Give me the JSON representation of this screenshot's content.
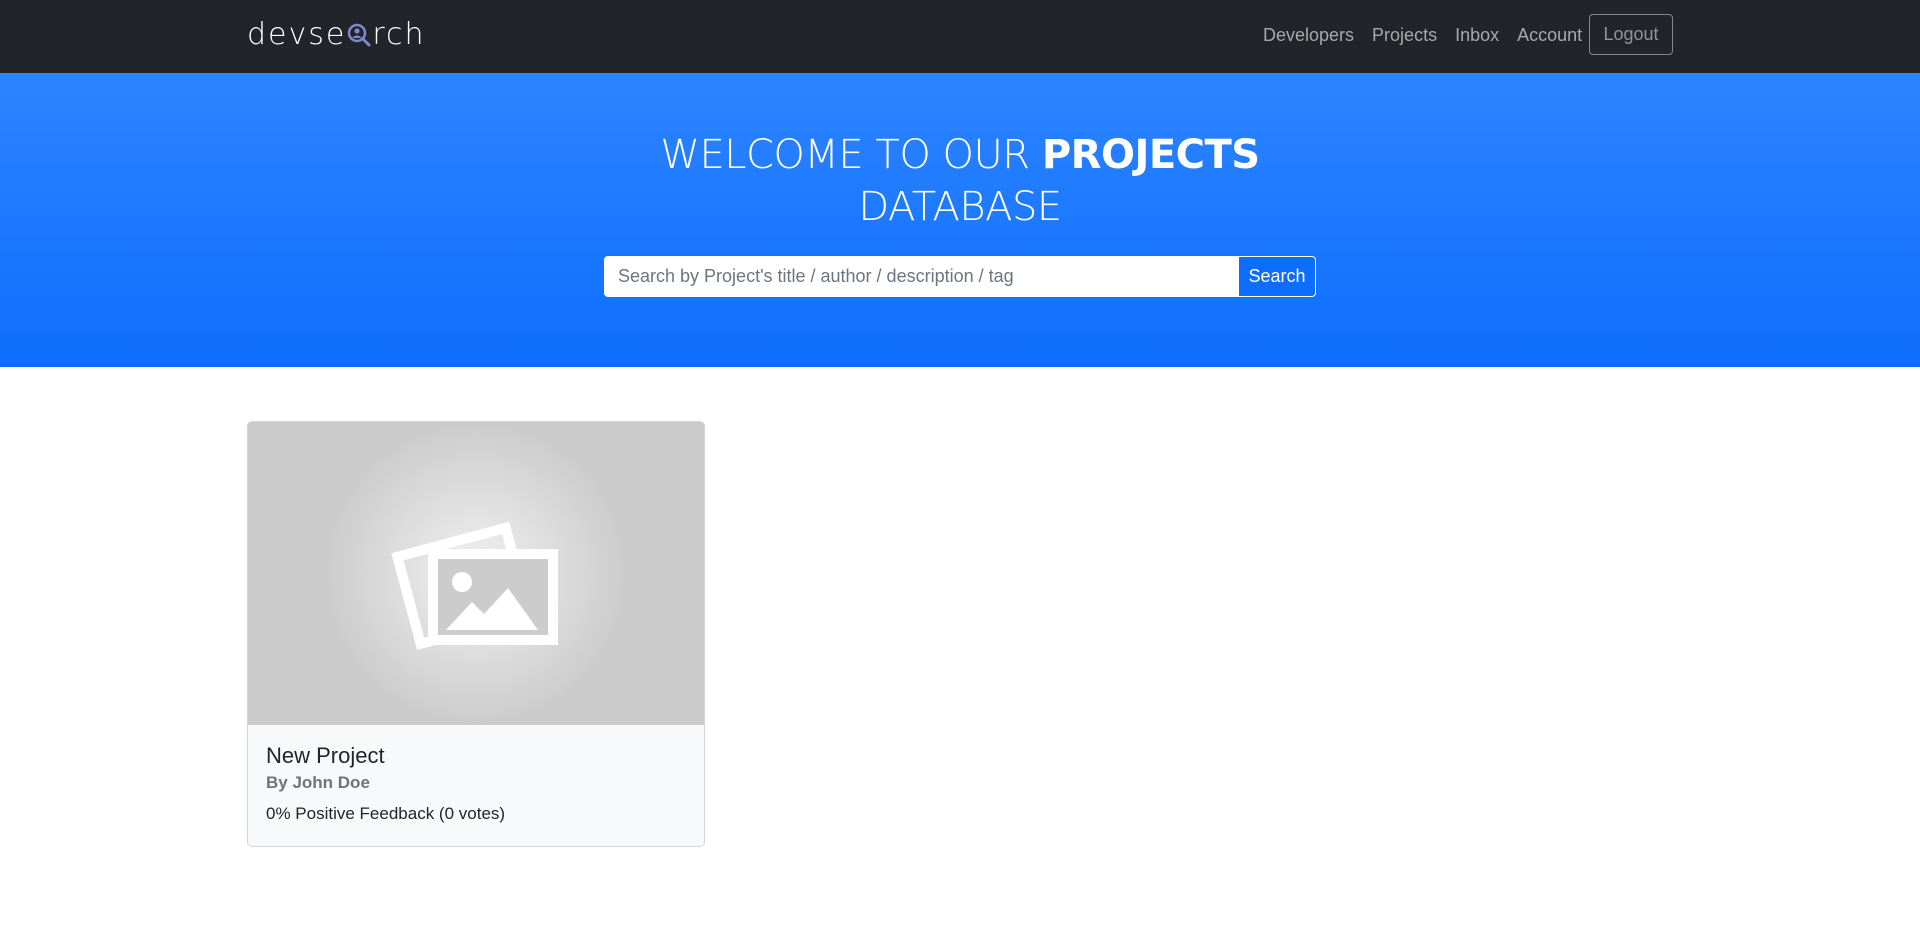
{
  "navbar": {
    "brand_prefix": "devse",
    "brand_suffix": "rch",
    "links": [
      "Developers",
      "Projects",
      "Inbox",
      "Account"
    ],
    "logout_label": "Logout"
  },
  "hero": {
    "title_light": "WELCOME TO OUR ",
    "title_bold": "PROJECTS",
    "title_line2": "DATABASE",
    "search_placeholder": "Search by Project's title / author / description / tag",
    "search_value": "",
    "search_button": "Search"
  },
  "projects": [
    {
      "title": "New Project",
      "author": "By John Doe",
      "feedback": "0% Positive Feedback (0 votes)",
      "image_icon": "image-placeholder-icon"
    }
  ],
  "colors": {
    "navbar_bg": "#212529",
    "hero_top": "#2d84ff",
    "hero_bottom": "#0d6efd",
    "card_bg": "#f8f9fa"
  }
}
